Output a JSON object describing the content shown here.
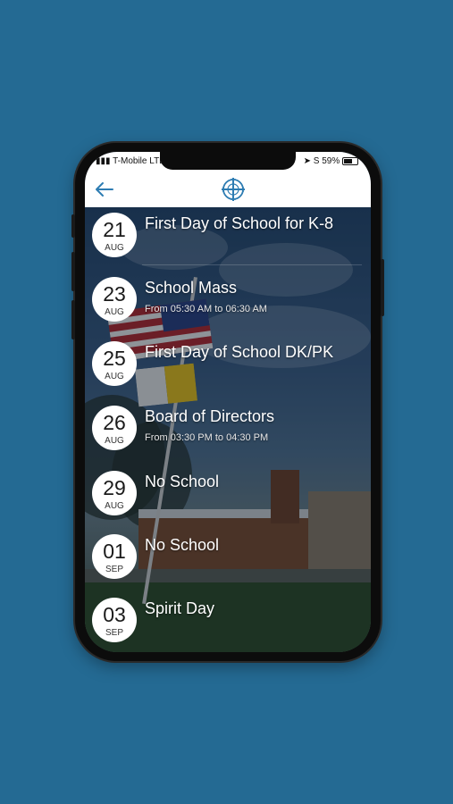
{
  "status_bar": {
    "carrier": "T-Mobile",
    "network": "LTE",
    "battery": "59%"
  },
  "nav": {
    "back_icon": "back-arrow-icon",
    "logo_icon": "cross-logo-icon"
  },
  "colors": {
    "background": "#246a93",
    "accent": "#2d7cb2"
  },
  "events": [
    {
      "day": "21",
      "month": "AUG",
      "title": "First Day of School for K-8",
      "time": ""
    },
    {
      "day": "23",
      "month": "AUG",
      "title": "School Mass",
      "time": "From 05:30 AM to 06:30 AM"
    },
    {
      "day": "25",
      "month": "AUG",
      "title": "First Day of School DK/PK",
      "time": ""
    },
    {
      "day": "26",
      "month": "AUG",
      "title": "Board of Directors",
      "time": "From 03:30 PM to 04:30 PM"
    },
    {
      "day": "29",
      "month": "AUG",
      "title": "No School",
      "time": ""
    },
    {
      "day": "01",
      "month": "SEP",
      "title": "No School",
      "time": ""
    },
    {
      "day": "03",
      "month": "SEP",
      "title": "Spirit Day",
      "time": ""
    }
  ]
}
